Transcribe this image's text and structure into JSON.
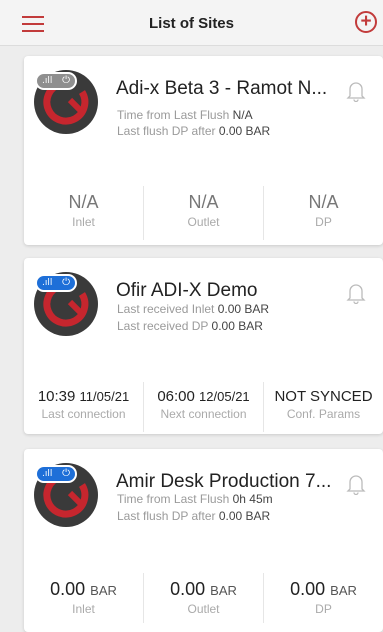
{
  "header": {
    "title": "List of Sites"
  },
  "sites": [
    {
      "name": "Adi-x Beta 3 - Ramot N...",
      "signal": "gray",
      "info": [
        {
          "label": "Time from Last Flush",
          "value": "N/A"
        },
        {
          "label": "Last flush DP after",
          "value": "0.00 BAR"
        }
      ],
      "stats": [
        {
          "value": "N/A",
          "label": "Inlet"
        },
        {
          "value": "N/A",
          "label": "Outlet"
        },
        {
          "value": "N/A",
          "label": "DP"
        }
      ]
    },
    {
      "name": "Ofir ADI-X Demo",
      "signal": "blue",
      "info": [
        {
          "label": "Last received Inlet",
          "value": "0.00 BAR"
        },
        {
          "label": "Last received DP",
          "value": "0.00 BAR"
        }
      ],
      "stats": [
        {
          "time": "10:39",
          "date": "11/05/21",
          "label": "Last connection"
        },
        {
          "time": "06:00",
          "date": "12/05/21",
          "label": "Next connection"
        },
        {
          "value": "NOT SYNCED",
          "label": "Conf. Params"
        }
      ]
    },
    {
      "name": "Amir Desk Production 7...",
      "signal": "blue",
      "info": [
        {
          "label": "Time from Last Flush",
          "value": "0h 45m"
        },
        {
          "label": "Last flush DP after",
          "value": "0.00 BAR"
        }
      ],
      "stats": [
        {
          "value": "0.00",
          "unit": "BAR",
          "label": "Inlet"
        },
        {
          "value": "0.00",
          "unit": "BAR",
          "label": "Outlet"
        },
        {
          "value": "0.00",
          "unit": "BAR",
          "label": "DP"
        }
      ]
    }
  ],
  "colors": {
    "accent": "#c23b3b",
    "signal_blue": "#1e6fd8",
    "signal_gray": "#8f8f8f"
  },
  "icons": {
    "menu": "hamburger-icon",
    "add": "plus-circle-icon",
    "bell": "bell-icon",
    "signal": "signal-icon",
    "plug": "plug-icon"
  }
}
